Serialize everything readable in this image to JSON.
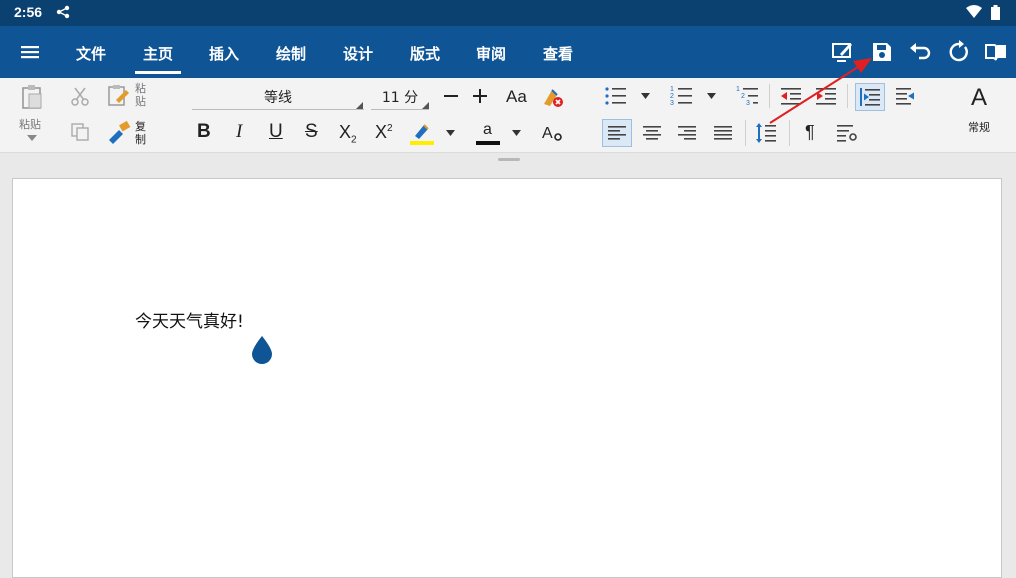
{
  "status": {
    "time": "2:56"
  },
  "menubar": {
    "tabs": [
      {
        "label": "文件"
      },
      {
        "label": "主页"
      },
      {
        "label": "插入"
      },
      {
        "label": "绘制"
      },
      {
        "label": "设计"
      },
      {
        "label": "版式"
      },
      {
        "label": "审阅"
      },
      {
        "label": "查看"
      }
    ],
    "active_tab": "主页"
  },
  "ribbon": {
    "paste_label": "粘贴",
    "paste_special_label": "粘贴",
    "copy_format_label": "复制",
    "font_name": "等线",
    "font_size": "11 分",
    "case_label": "Aa",
    "style_label": "常规"
  },
  "document": {
    "text": "今天天气真好!"
  },
  "colors": {
    "accent": "#0f5596",
    "statusbar": "#0a4170",
    "arrow": "#e02020",
    "highlight": "#ffee00"
  }
}
